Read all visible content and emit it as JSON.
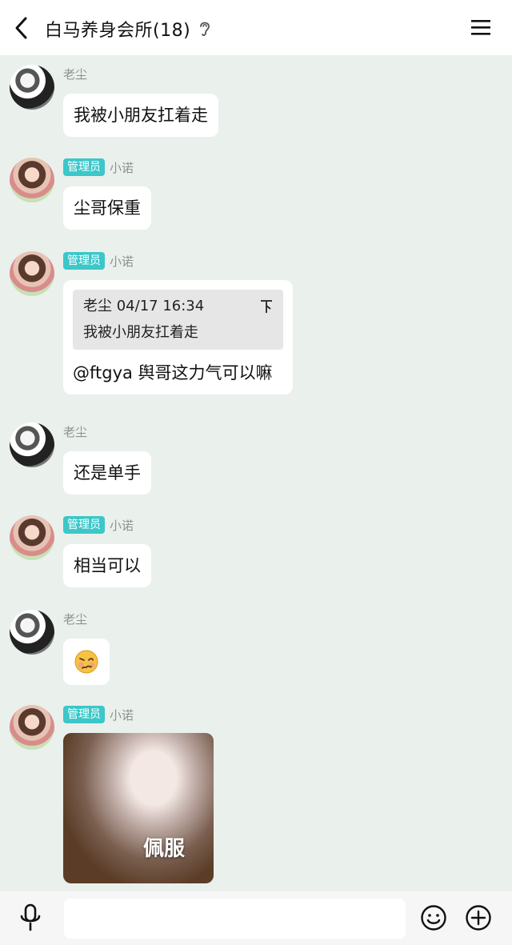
{
  "header": {
    "title": "白马养身会所(18)",
    "back_icon": "chevron-left-icon",
    "ear_icon": "ear-icon",
    "menu_icon": "hamburger-menu-icon"
  },
  "messages": [
    {
      "sender": "老尘",
      "admin": false,
      "type": "text",
      "text": "我被小朋友扛着走"
    },
    {
      "sender": "小诺",
      "admin": true,
      "admin_label": "管理员",
      "type": "text",
      "text": "尘哥保重"
    },
    {
      "sender": "小诺",
      "admin": true,
      "admin_label": "管理员",
      "type": "reply",
      "quote_author_time": "老尘 04/17 16:34",
      "quote_text": "我被小朋友扛着走",
      "text": "@ftgya 舆哥这力气可以嘛"
    },
    {
      "sender": "老尘",
      "admin": false,
      "type": "text",
      "text": "还是单手"
    },
    {
      "sender": "小诺",
      "admin": true,
      "admin_label": "管理员",
      "type": "text",
      "text": "相当可以"
    },
    {
      "sender": "老尘",
      "admin": false,
      "type": "emoji",
      "emoji": "🥴"
    },
    {
      "sender": "小诺",
      "admin": true,
      "admin_label": "管理员",
      "type": "image",
      "caption": "佩服"
    }
  ],
  "input": {
    "placeholder": ""
  },
  "colors": {
    "admin_badge": "#3cc7c9",
    "chat_bg": "#eaf0ec",
    "bubble": "#ffffff"
  }
}
